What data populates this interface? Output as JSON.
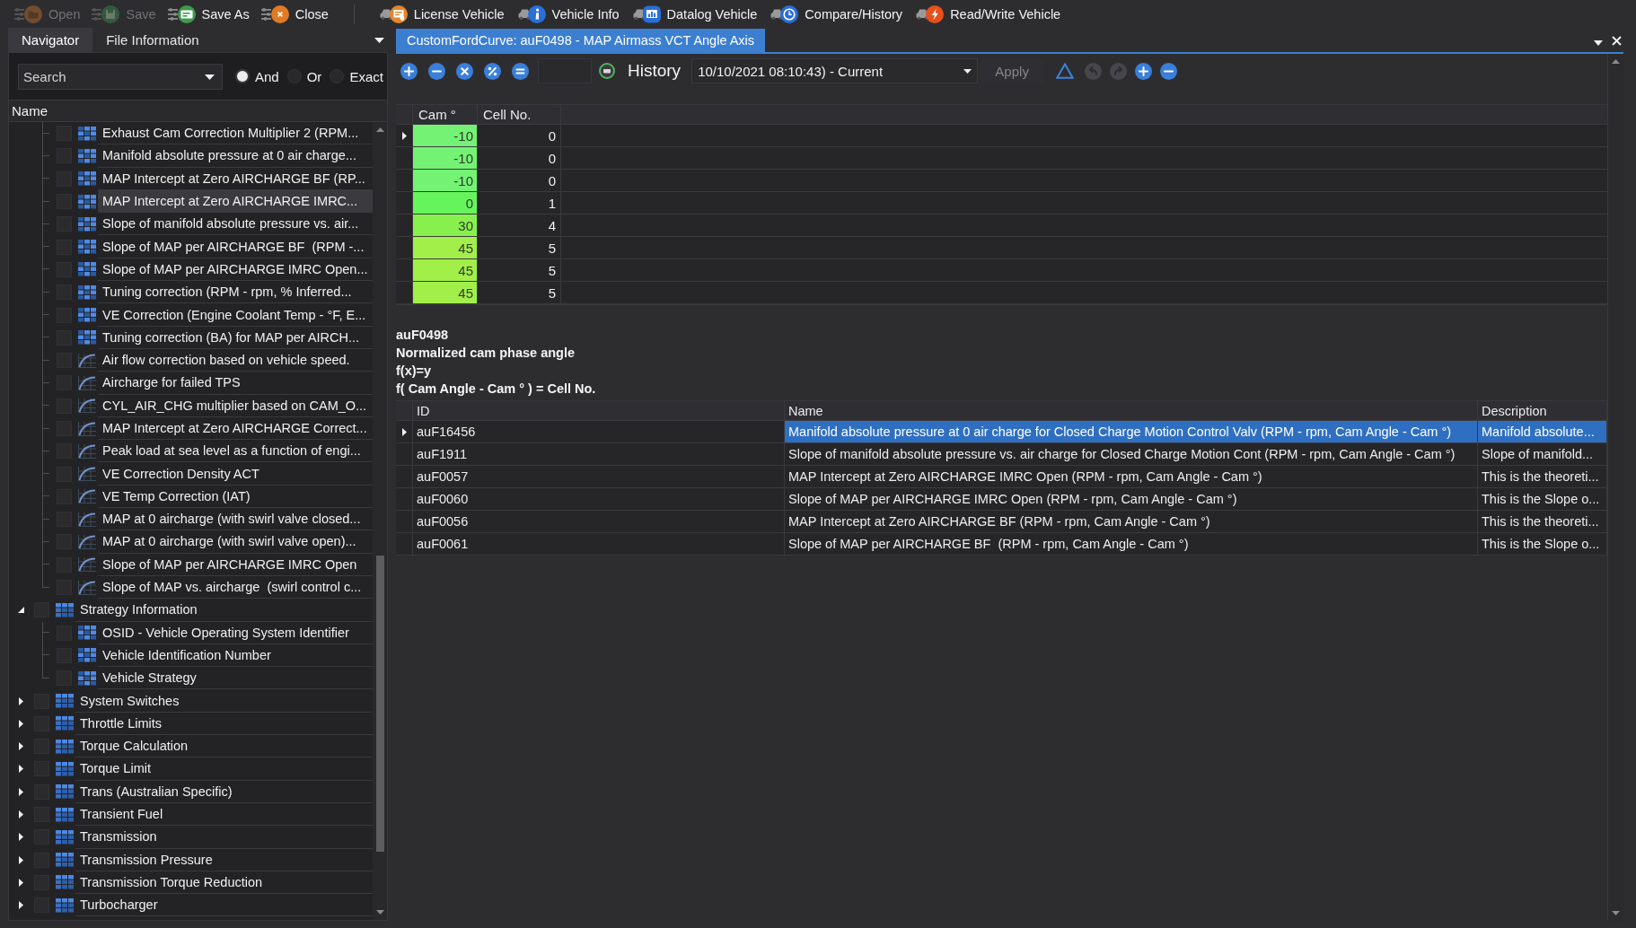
{
  "toolbar": {
    "groups": [
      {
        "buttons": [
          {
            "label": "Open",
            "kind": "open",
            "disabled": true
          },
          {
            "label": "Save",
            "kind": "save",
            "disabled": true
          },
          {
            "label": "Save As",
            "kind": "saveas",
            "disabled": false
          },
          {
            "label": "Close",
            "kind": "close",
            "disabled": false
          }
        ]
      },
      {
        "buttons": [
          {
            "label": "License Vehicle",
            "kind": "license",
            "disabled": false
          },
          {
            "label": "Vehicle Info",
            "kind": "info",
            "disabled": false
          },
          {
            "label": "Datalog Vehicle",
            "kind": "datalog",
            "disabled": false
          },
          {
            "label": "Compare/History",
            "kind": "history",
            "disabled": false
          },
          {
            "label": "Read/Write Vehicle",
            "kind": "readwrite",
            "disabled": false
          }
        ]
      }
    ]
  },
  "navigator": {
    "tabs": [
      {
        "label": "Navigator",
        "selected": true
      },
      {
        "label": "File Information",
        "selected": false
      }
    ],
    "search": {
      "placeholder": "Search"
    },
    "match_modes": [
      {
        "label": "And",
        "selected": true
      },
      {
        "label": "Or",
        "selected": false
      },
      {
        "label": "Exact",
        "selected": false
      }
    ],
    "tree": {
      "column": "Name",
      "items": [
        {
          "children": [
            {
              "label": "Exhaust Cam Correction Multiplier 2 (RPM...",
              "kind": "table",
              "checked": false,
              "selected": false
            },
            {
              "label": "Manifold absolute pressure at 0 air charge...",
              "kind": "table",
              "checked": false,
              "selected": false
            },
            {
              "label": "MAP Intercept at Zero AIRCHARGE BF (RP...",
              "kind": "table",
              "checked": false,
              "selected": false
            },
            {
              "label": "MAP Intercept at Zero AIRCHARGE IMRC...",
              "kind": "table",
              "checked": false,
              "selected": true
            },
            {
              "label": "Slope of manifold absolute pressure vs. air...",
              "kind": "table",
              "checked": false,
              "selected": false
            },
            {
              "label": "Slope of MAP per AIRCHARGE BF  (RPM -...",
              "kind": "table",
              "checked": false,
              "selected": false
            },
            {
              "label": "Slope of MAP per AIRCHARGE IMRC Open...",
              "kind": "table",
              "checked": false,
              "selected": false
            },
            {
              "label": "Tuning correction (RPM - rpm, % Inferred...",
              "kind": "table",
              "checked": false,
              "selected": false
            },
            {
              "label": "VE Correction (Engine Coolant Temp - °F, E...",
              "kind": "table",
              "checked": false,
              "selected": false
            },
            {
              "label": "Tuning correction (BA) for MAP per AIRCH...",
              "kind": "table",
              "checked": false,
              "selected": false
            },
            {
              "label": "Air flow correction based on vehicle speed.",
              "kind": "curve",
              "checked": false,
              "selected": false
            },
            {
              "label": "Aircharge for failed TPS",
              "kind": "curve",
              "checked": false,
              "selected": false
            },
            {
              "label": "CYL_AIR_CHG multiplier based on CAM_O...",
              "kind": "curve",
              "checked": false,
              "selected": false
            },
            {
              "label": "MAP Intercept at Zero AIRCHARGE Correct...",
              "kind": "curve",
              "checked": false,
              "selected": false
            },
            {
              "label": "Peak load at sea level as a function of engi...",
              "kind": "curve",
              "checked": false,
              "selected": false
            },
            {
              "label": "VE Correction Density ACT",
              "kind": "curve",
              "checked": false,
              "selected": false
            },
            {
              "label": "VE Temp Correction (IAT)",
              "kind": "curve",
              "checked": false,
              "selected": false
            },
            {
              "label": "MAP at 0 aircharge (with swirl valve closed...",
              "kind": "curve",
              "checked": false,
              "selected": false
            },
            {
              "label": "MAP at 0 aircharge (with swirl valve open)...",
              "kind": "curve",
              "checked": false,
              "selected": false
            },
            {
              "label": "Slope of MAP per AIRCHARGE IMRC Open",
              "kind": "curve",
              "checked": false,
              "selected": false
            },
            {
              "label": "Slope of MAP vs. aircharge  (swirl control c...",
              "kind": "curve",
              "checked": false,
              "selected": false
            }
          ]
        },
        {
          "label": "Strategy Information",
          "kind": "group",
          "expanded": true,
          "checked": false,
          "selected": false,
          "children": [
            {
              "label": "OSID - Vehicle Operating System Identifier",
              "kind": "table",
              "checked": false,
              "selected": false
            },
            {
              "label": "Vehicle Identification Number",
              "kind": "table",
              "checked": false,
              "selected": false
            },
            {
              "label": "Vehicle Strategy",
              "kind": "table",
              "checked": false,
              "selected": false
            }
          ]
        },
        {
          "label": "System Switches",
          "kind": "group",
          "expanded": false,
          "checked": false,
          "selected": false
        },
        {
          "label": "Throttle Limits",
          "kind": "group",
          "expanded": false,
          "checked": false,
          "selected": false
        },
        {
          "label": "Torque Calculation",
          "kind": "group",
          "expanded": false,
          "checked": false,
          "selected": false
        },
        {
          "label": "Torque Limit",
          "kind": "group",
          "expanded": false,
          "checked": false,
          "selected": false
        },
        {
          "label": "Trans (Australian Specific)",
          "kind": "group",
          "expanded": false,
          "checked": false,
          "selected": false
        },
        {
          "label": "Transient Fuel",
          "kind": "group",
          "expanded": false,
          "checked": false,
          "selected": false
        },
        {
          "label": "Transmission",
          "kind": "group",
          "expanded": false,
          "checked": false,
          "selected": false
        },
        {
          "label": "Transmission Pressure",
          "kind": "group",
          "expanded": false,
          "checked": false,
          "selected": false
        },
        {
          "label": "Transmission Torque Reduction",
          "kind": "group",
          "expanded": false,
          "checked": false,
          "selected": false
        },
        {
          "label": "Turbocharger",
          "kind": "group",
          "expanded": false,
          "checked": false,
          "selected": false
        }
      ]
    }
  },
  "document": {
    "tab": {
      "label": "CustomFordCurve: auF0498 - MAP Airmass VCT Angle Axis",
      "selected": true
    },
    "toolbar": {
      "math_tools": [
        {
          "kind": "add"
        },
        {
          "kind": "subtract"
        },
        {
          "kind": "multiply"
        },
        {
          "kind": "percent"
        },
        {
          "kind": "equals"
        }
      ],
      "history": {
        "label": "History",
        "value": "10/10/2021 08:10:43) - Current"
      },
      "apply": {
        "label": "Apply",
        "disabled": true
      },
      "edit_tools": [
        {
          "kind": "delta",
          "disabled": false
        },
        {
          "kind": "undo",
          "disabled": true
        },
        {
          "kind": "redo",
          "disabled": true
        },
        {
          "kind": "add",
          "disabled": false
        },
        {
          "kind": "subtract",
          "disabled": false
        }
      ]
    },
    "axis_table": {
      "columns": [
        "Cam °",
        "Cell No."
      ],
      "rows": [
        {
          "cam": "-10",
          "cell_no": "0",
          "color": "#74f274",
          "selected": true
        },
        {
          "cam": "-10",
          "cell_no": "0",
          "color": "#74f274",
          "selected": false
        },
        {
          "cam": "-10",
          "cell_no": "0",
          "color": "#74f274",
          "selected": false
        },
        {
          "cam": "0",
          "cell_no": "1",
          "color": "#66f45c",
          "selected": false
        },
        {
          "cam": "30",
          "cell_no": "4",
          "color": "#88f04c",
          "selected": false
        },
        {
          "cam": "45",
          "cell_no": "5",
          "color": "#a2ef4a",
          "selected": false
        },
        {
          "cam": "45",
          "cell_no": "5",
          "color": "#a2ef4a",
          "selected": false
        },
        {
          "cam": "45",
          "cell_no": "5",
          "color": "#a2ef4a",
          "selected": false
        }
      ]
    },
    "info": [
      "auF0498",
      "Normalized cam phase angle",
      "f(x)=y",
      "f( Cam Angle - Cam ° ) = Cell No."
    ],
    "references": {
      "columns": [
        "ID",
        "Name",
        "Description"
      ],
      "rows": [
        {
          "id": "auF16456",
          "name": "Manifold absolute pressure at 0 air charge for Closed Charge Motion Control Valv (RPM - rpm, Cam Angle - Cam °)",
          "description": "Manifold absolute...",
          "selected": true
        },
        {
          "id": "auF1911",
          "name": "Slope of manifold absolute pressure vs. air charge for Closed Charge Motion Cont (RPM - rpm, Cam Angle - Cam °)",
          "description": "Slope of manifold...",
          "selected": false
        },
        {
          "id": "auF0057",
          "name": "MAP Intercept at Zero AIRCHARGE IMRC Open (RPM - rpm, Cam Angle - Cam °)",
          "description": "This is the theoreti...",
          "selected": false
        },
        {
          "id": "auF0060",
          "name": "Slope of MAP per AIRCHARGE IMRC Open (RPM - rpm, Cam Angle - Cam °)",
          "description": "This is the Slope o...",
          "selected": false
        },
        {
          "id": "auF0056",
          "name": "MAP Intercept at Zero AIRCHARGE BF (RPM - rpm, Cam Angle - Cam °)",
          "description": "This is the theoreti...",
          "selected": false
        },
        {
          "id": "auF0061",
          "name": "Slope of MAP per AIRCHARGE BF  (RPM - rpm, Cam Angle - Cam °)",
          "description": "This is the Slope o...",
          "selected": false
        }
      ]
    }
  }
}
